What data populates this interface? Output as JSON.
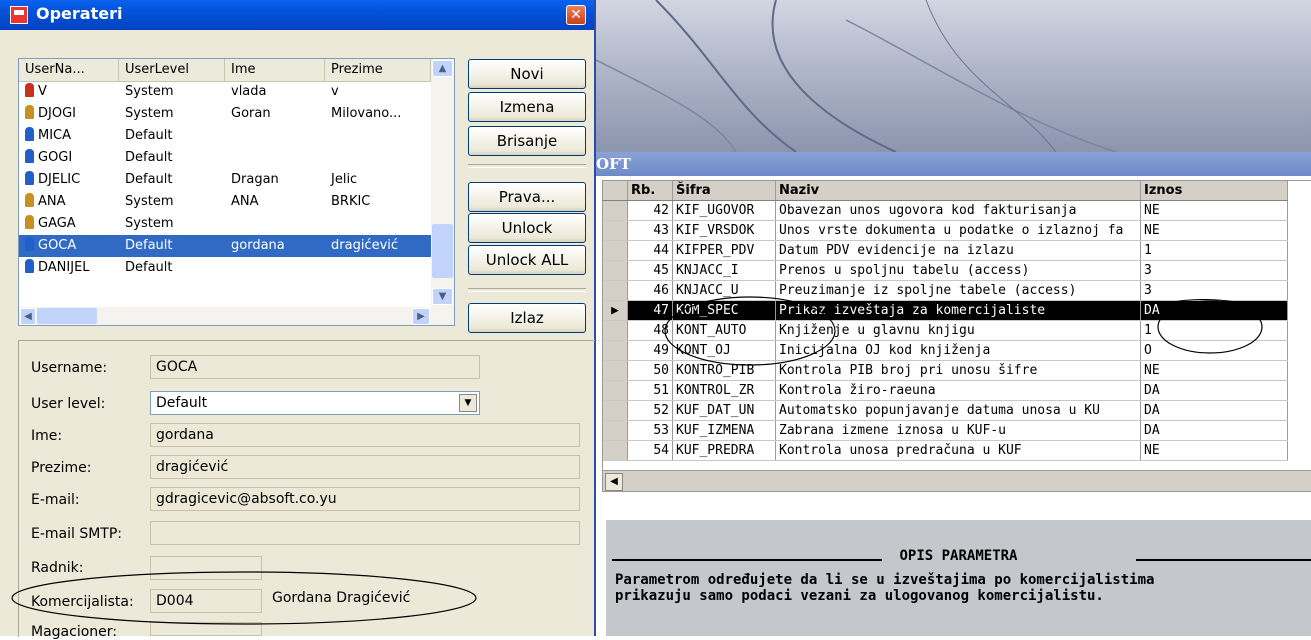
{
  "dialog": {
    "title": "Operateri",
    "columns": [
      "UserNa...",
      "UserLevel",
      "Ime",
      "Prezime"
    ],
    "users": [
      {
        "username": "V",
        "level": "System",
        "ime": "vlada",
        "prezime": "v",
        "icon_color": "#c83020"
      },
      {
        "username": "DJOGI",
        "level": "System",
        "ime": "Goran",
        "prezime": "Milovano...",
        "icon_color": "#c89020"
      },
      {
        "username": "MICA",
        "level": "Default",
        "ime": "",
        "prezime": "",
        "icon_color": "#2060c8"
      },
      {
        "username": "GOGI",
        "level": "Default",
        "ime": "",
        "prezime": "",
        "icon_color": "#2060c8"
      },
      {
        "username": "DJELIC",
        "level": "Default",
        "ime": "Dragan",
        "prezime": "Jelic",
        "icon_color": "#2060c8"
      },
      {
        "username": "ANA",
        "level": "System",
        "ime": "ANA",
        "prezime": "BRKIC",
        "icon_color": "#c89020"
      },
      {
        "username": "GAGA",
        "level": "System",
        "ime": "",
        "prezime": "",
        "icon_color": "#c89020"
      },
      {
        "username": "GOCA",
        "level": "Default",
        "ime": "gordana",
        "prezime": "dragićević",
        "icon_color": "#2060c8"
      },
      {
        "username": "DANIJEL",
        "level": "Default",
        "ime": "",
        "prezime": "",
        "icon_color": "#2060c8"
      }
    ],
    "selected_index": 7,
    "buttons": {
      "novi": "Novi",
      "izmena": "Izmena",
      "brisanje": "Brisanje",
      "prava": "Prava...",
      "unlock": "Unlock",
      "unlock_all": "Unlock ALL",
      "izlaz": "Izlaz"
    },
    "form": {
      "username_label": "Username:",
      "username_value": "GOCA",
      "userlevel_label": "User level:",
      "userlevel_value": "Default",
      "ime_label": "Ime:",
      "ime_value": "gordana",
      "prezime_label": "Prezime:",
      "prezime_value": "dragićević",
      "email_label": "E-mail:",
      "email_value": "gdragicevic@absoft.co.yu",
      "smtp_label": "E-mail SMTP:",
      "smtp_value": "",
      "radnik_label": "Radnik:",
      "radnik_value": "",
      "komercijalista_label": "Komercijalista:",
      "komercijalista_code": "D004",
      "komercijalista_name": "Gordana Dragićević",
      "magacioner_label": "Magacioner:"
    }
  },
  "background_app": {
    "title_fragment": "OFT",
    "columns": [
      "Rb.",
      "Šifra",
      "Naziv",
      "Iznos"
    ],
    "rows": [
      {
        "rb": "42",
        "sifra": "KIF_UGOVOR",
        "naziv": "Obavezan unos ugovora kod fakturisanja",
        "iznos": "NE"
      },
      {
        "rb": "43",
        "sifra": "KIF_VRSDOK",
        "naziv": "Unos vrste dokumenta u podatke o izlaznoj fa",
        "iznos": "NE"
      },
      {
        "rb": "44",
        "sifra": "KIFPER_PDV",
        "naziv": "Datum PDV evidencije na izlazu",
        "iznos": "1"
      },
      {
        "rb": "45",
        "sifra": "KNJACC_I",
        "naziv": "Prenos u spoljnu tabelu (access)",
        "iznos": "3"
      },
      {
        "rb": "46",
        "sifra": "KNJACC_U",
        "naziv": "Preuzimanje iz spoljne tabele (access)",
        "iznos": "3"
      },
      {
        "rb": "47",
        "sifra": "KOM_SPEC",
        "naziv": "Prikaz izveštaja za komercijaliste",
        "iznos": "DA"
      },
      {
        "rb": "48",
        "sifra": "KONT_AUTO",
        "naziv": "Knjiženje u glavnu knjigu",
        "iznos": "1"
      },
      {
        "rb": "49",
        "sifra": "KONT_OJ",
        "naziv": "Inicijalna OJ kod knjiženja",
        "iznos": "O"
      },
      {
        "rb": "50",
        "sifra": "KONTRO_PIB",
        "naziv": "Kontrola PIB broj pri unosu šifre",
        "iznos": "NE"
      },
      {
        "rb": "51",
        "sifra": "KONTROL_ZR",
        "naziv": "Kontrola žiro-raeuna",
        "iznos": "DA"
      },
      {
        "rb": "52",
        "sifra": "KUF_DAT_UN",
        "naziv": "Automatsko popunjavanje datuma unosa u KU",
        "iznos": "DA"
      },
      {
        "rb": "53",
        "sifra": "KUF_IZMENA",
        "naziv": "Zabrana izmene iznosa u KUF-u",
        "iznos": "DA"
      },
      {
        "rb": "54",
        "sifra": "KUF_PREDRA",
        "naziv": "Kontrola unosa predračuna u KUF",
        "iznos": "NE"
      }
    ],
    "selected_index": 5,
    "desc_title": "OPIS PARAMETRA",
    "desc_text_1": "Parametrom određujete da li se u izveštajima po komercijalistima",
    "desc_text_2": "prikazuju samo podaci vezani za ulogovanog komercijalistu."
  }
}
